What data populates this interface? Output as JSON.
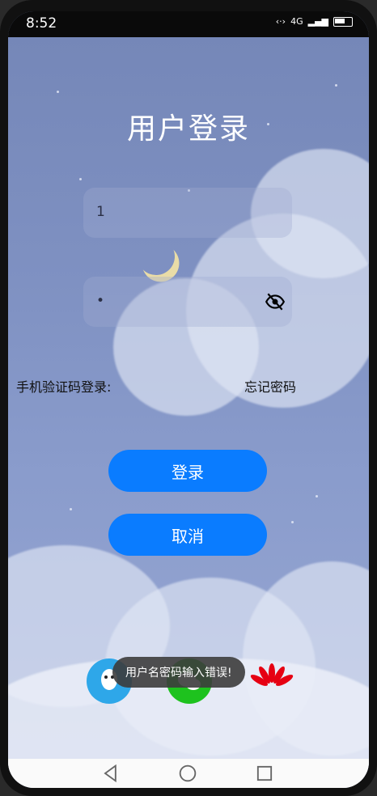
{
  "status_bar": {
    "time": "8:52",
    "network": "4G"
  },
  "page": {
    "title": "用户登录",
    "username_value": "1",
    "password_value": "•",
    "sms_login_label": "手机验证码登录:",
    "forgot_password_label": "忘记密码",
    "login_button": "登录",
    "cancel_button": "取消"
  },
  "social_logins": [
    {
      "name": "qq-icon",
      "color": "#2ea7e9"
    },
    {
      "name": "wechat-icon",
      "color": "#1ec21e"
    },
    {
      "name": "huawei-icon",
      "color": "#e60012"
    }
  ],
  "toast": {
    "message": "用户名密码输入错误!"
  },
  "colors": {
    "accent": "#0a7cff",
    "background": "#7f91c2"
  },
  "nav_bar": {
    "icons": [
      "back-icon",
      "home-icon",
      "recents-icon"
    ]
  }
}
